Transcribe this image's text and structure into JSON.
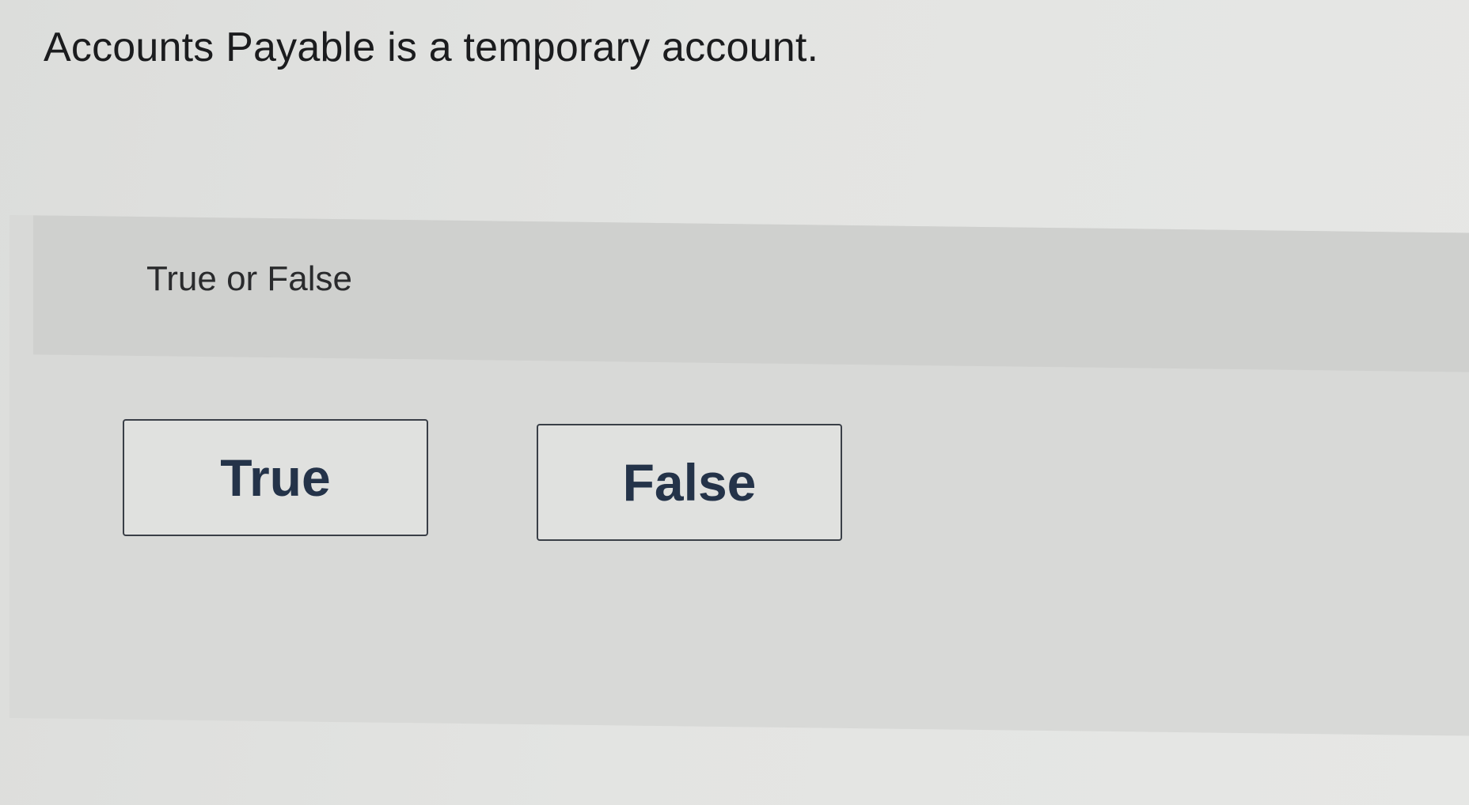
{
  "question": {
    "text": "Accounts Payable is a temporary account."
  },
  "instruction": "True or False",
  "choices": [
    {
      "label": "True"
    },
    {
      "label": "False"
    }
  ],
  "colors": {
    "background": "#e3e4e2",
    "panel": "#d8d9d7",
    "button_text": "#243349",
    "button_border": "#3a3f47"
  }
}
